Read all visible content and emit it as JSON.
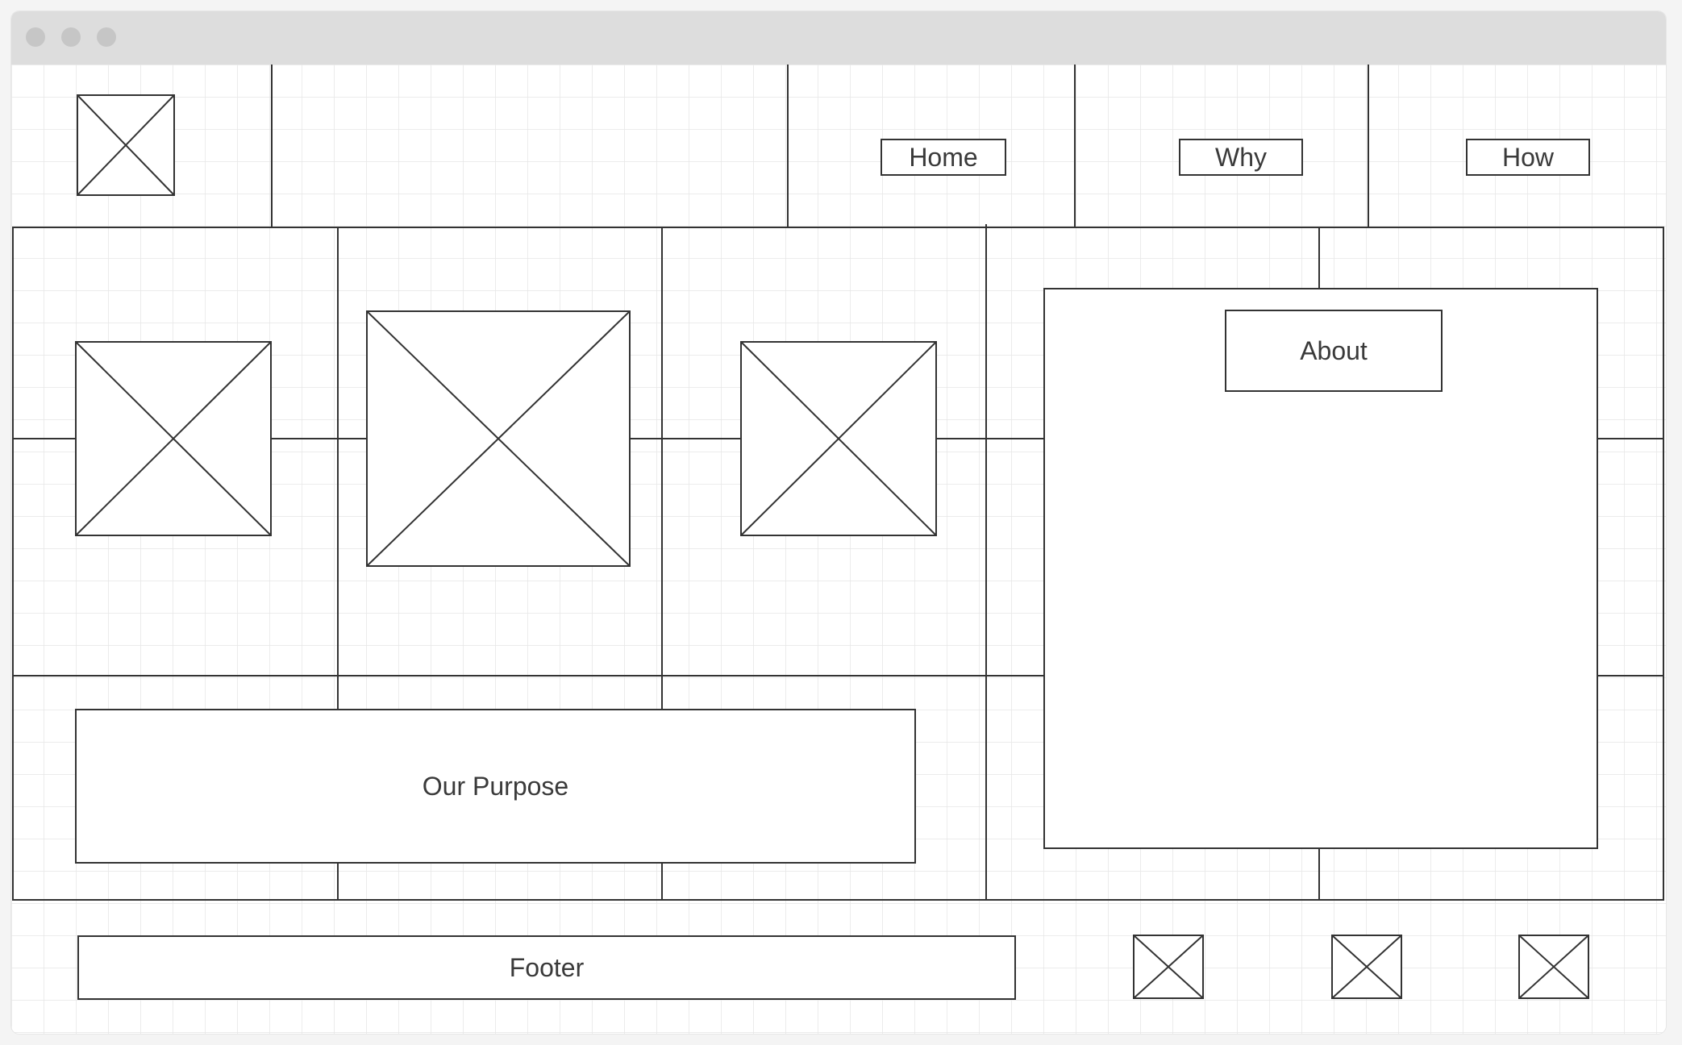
{
  "nav": {
    "home_label": "Home",
    "why_label": "Why",
    "how_label": "How"
  },
  "content": {
    "about_label": "About",
    "purpose_label": "Our Purpose"
  },
  "footer": {
    "label": "Footer"
  },
  "icons": {
    "image_placeholder": "image-placeholder-icon"
  },
  "colors": {
    "titlebar": "#dddddd",
    "window_dot": "#c6c6c6",
    "grid_line": "#e6e6e6",
    "wire_line": "#333333",
    "text": "#3a3a3a"
  }
}
